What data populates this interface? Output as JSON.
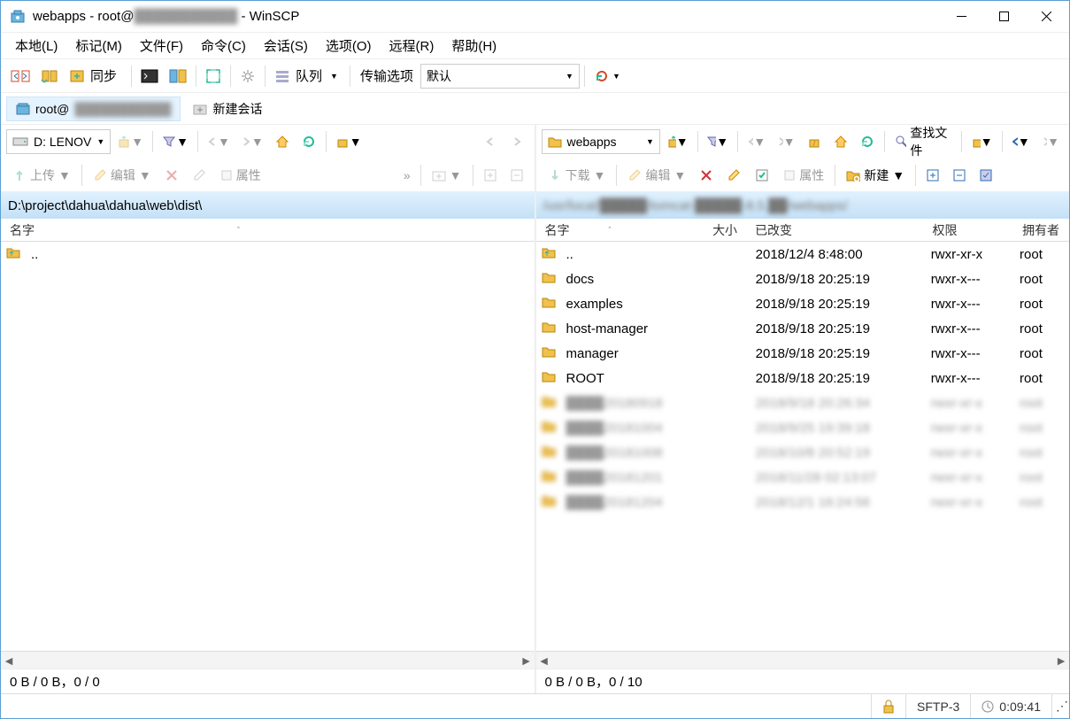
{
  "title": {
    "prefix": "webapps - root@",
    "host_obscured": "███████████",
    "suffix": " - WinSCP"
  },
  "menu": [
    "本地(L)",
    "标记(M)",
    "文件(F)",
    "命令(C)",
    "会话(S)",
    "选项(O)",
    "远程(R)",
    "帮助(H)"
  ],
  "toolbar1": {
    "sync_label": "同步",
    "queue_label": "队列",
    "transfer_label": "传输选项",
    "transfer_value": "默认"
  },
  "sessions": {
    "active_prefix": "root@",
    "active_host_obscured": "███████████",
    "new_label": "新建会话"
  },
  "left": {
    "drive": "D: LENOV",
    "actions": {
      "upload": "上传",
      "edit": "编辑",
      "props": "属性"
    },
    "path": "D:\\project\\dahua\\dahua\\web\\dist\\",
    "columns": {
      "name": "名字"
    },
    "rows": [
      {
        "name": "..",
        "type": "up"
      }
    ],
    "stats": "0 B / 0 B，0 / 0"
  },
  "right": {
    "folder": "webapps",
    "actions": {
      "download": "下载",
      "edit": "编辑",
      "props": "属性",
      "new": "新建",
      "find": "查找文件"
    },
    "path_obscured": "/usr/local/█████/tomcat-█████-8.5.██/webapps/",
    "columns": {
      "name": "名字",
      "size": "大小",
      "changed": "已改变",
      "rights": "权限",
      "owner": "拥有者"
    },
    "rows": [
      {
        "name": "..",
        "type": "up",
        "changed": "2018/12/4 8:48:00",
        "rights": "rwxr-xr-x",
        "owner": "root"
      },
      {
        "name": "docs",
        "type": "folder",
        "changed": "2018/9/18 20:25:19",
        "rights": "rwxr-x---",
        "owner": "root"
      },
      {
        "name": "examples",
        "type": "folder",
        "changed": "2018/9/18 20:25:19",
        "rights": "rwxr-x---",
        "owner": "root"
      },
      {
        "name": "host-manager",
        "type": "folder",
        "changed": "2018/9/18 20:25:19",
        "rights": "rwxr-x---",
        "owner": "root"
      },
      {
        "name": "manager",
        "type": "folder",
        "changed": "2018/9/18 20:25:19",
        "rights": "rwxr-x---",
        "owner": "root"
      },
      {
        "name": "ROOT",
        "type": "folder",
        "changed": "2018/9/18 20:25:19",
        "rights": "rwxr-x---",
        "owner": "root"
      },
      {
        "name": "████20180918",
        "type": "folder",
        "changed": "2018/9/18 20:26:34",
        "rights": "rwxr-xr-x",
        "owner": "root",
        "obscured": true
      },
      {
        "name": "████20181004",
        "type": "folder",
        "changed": "2018/9/25 19:39:18",
        "rights": "rwxr-xr-x",
        "owner": "root",
        "obscured": true
      },
      {
        "name": "████20181008",
        "type": "folder",
        "changed": "2018/10/8 20:52:19",
        "rights": "rwxr-xr-x",
        "owner": "root",
        "obscured": true
      },
      {
        "name": "████20181201",
        "type": "folder",
        "changed": "2018/11/28 02:13:07",
        "rights": "rwxr-xr-x",
        "owner": "root",
        "obscured": true
      },
      {
        "name": "████20181204",
        "type": "folder",
        "changed": "2018/12/1 16:24:56",
        "rights": "rwxr-xr-x",
        "owner": "root",
        "obscured": true
      }
    ],
    "stats": "0 B / 0 B，0 / 10"
  },
  "status": {
    "protocol": "SFTP-3",
    "elapsed": "0:09:41"
  }
}
